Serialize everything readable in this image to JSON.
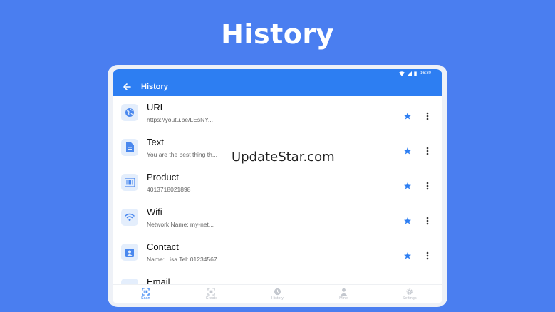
{
  "promo": {
    "title": "History"
  },
  "status_bar": {
    "time": "16:30"
  },
  "app_bar": {
    "title": "History"
  },
  "history_items": [
    {
      "title": "URL",
      "subtitle": "https://youtu.be/LEsNY...",
      "icon": "globe-icon"
    },
    {
      "title": "Text",
      "subtitle": "You are the best thing th...",
      "icon": "document-icon"
    },
    {
      "title": "Product",
      "subtitle": "4013718021898",
      "icon": "barcode-icon"
    },
    {
      "title": "Wifi",
      "subtitle": "Network Name: my-net...",
      "icon": "wifi-icon"
    },
    {
      "title": "Contact",
      "subtitle": "Name: Lisa Tel: 01234567",
      "icon": "contact-icon"
    },
    {
      "title": "Email",
      "subtitle": "",
      "icon": "email-icon"
    }
  ],
  "bottom_nav": [
    {
      "label": "Scan",
      "icon": "scan-icon",
      "active": true
    },
    {
      "label": "Create",
      "icon": "create-icon",
      "active": false
    },
    {
      "label": "History",
      "icon": "history-icon",
      "active": false
    },
    {
      "label": "Mine",
      "icon": "person-icon",
      "active": false
    },
    {
      "label": "Settings",
      "icon": "gear-icon",
      "active": false
    }
  ],
  "watermark": {
    "text": "UpdateStar.com"
  },
  "colors": {
    "background": "#4a7ef0",
    "primary": "#2d7ef2",
    "icon_bg": "#e4eefc"
  }
}
